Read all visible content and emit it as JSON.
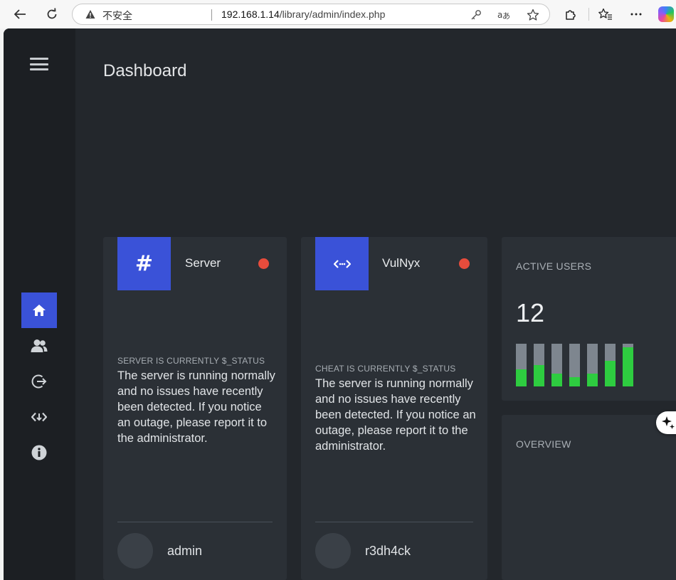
{
  "browser": {
    "security_label": "不安全",
    "url_host": "192.168.1.14",
    "url_path": "/library/admin/index.php"
  },
  "page": {
    "title": "Dashboard"
  },
  "sidebar": {
    "items": [
      {
        "icon": "home-icon"
      },
      {
        "icon": "users-icon"
      },
      {
        "icon": "logout-icon"
      },
      {
        "icon": "code-icon"
      },
      {
        "icon": "info-icon"
      }
    ]
  },
  "cards": [
    {
      "icon_text": "#",
      "name": "Server",
      "caption": "SERVER IS CURRENTLY $_STATUS",
      "text": "The server is running normally and no issues have recently been detected. If you notice an outage, please report it to the administrator.",
      "user": "admin"
    },
    {
      "icon_text": "<·>",
      "name": "VulNyx",
      "caption": "CHEAT IS CURRENTLY $_STATUS",
      "text": "The server is running normally and no issues have recently been detected. If you notice an outage, please report it to the administrator.",
      "user": "r3dh4ck"
    }
  ],
  "active_users": {
    "title": "ACTIVE USERS",
    "value": "12",
    "bars": [
      0.4,
      0.5,
      0.3,
      0.22,
      0.3,
      0.6,
      0.92
    ]
  },
  "overview": {
    "title": "OVERVIEW"
  },
  "colors": {
    "accent": "#3a52d8",
    "status_red": "#e74c3c",
    "bar_green": "#2ecc40",
    "background": "#23272c"
  }
}
